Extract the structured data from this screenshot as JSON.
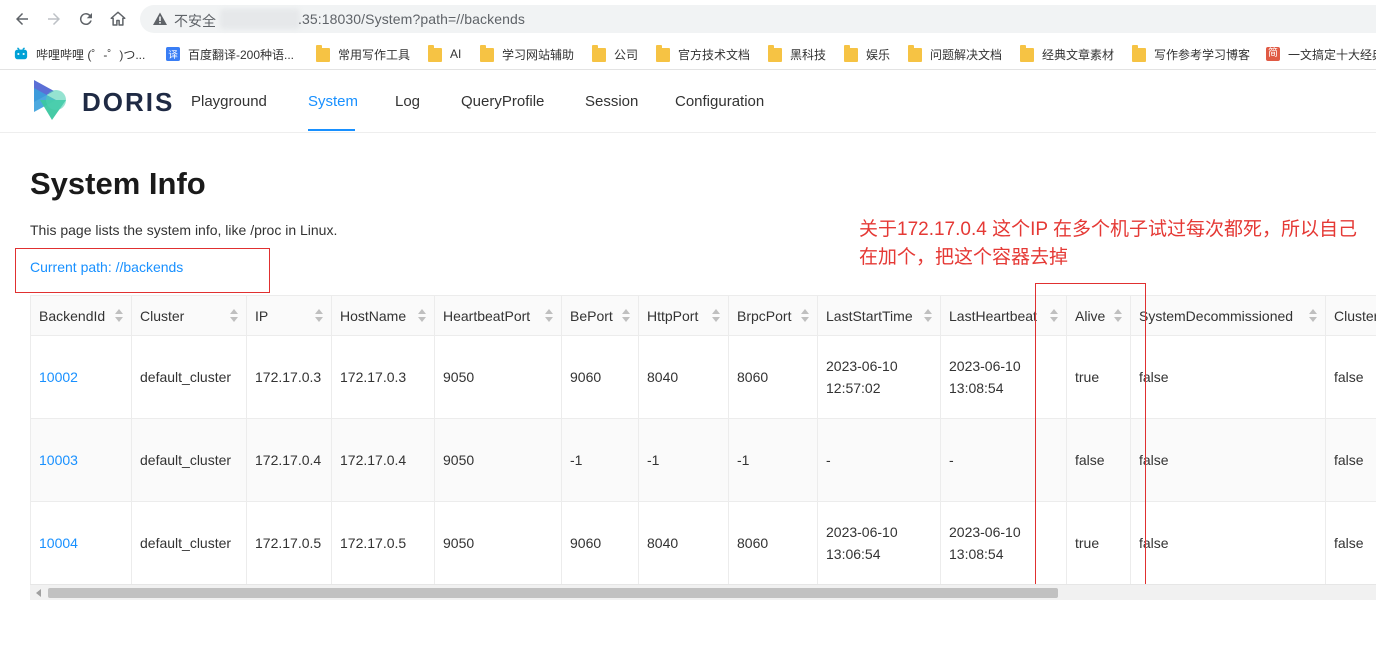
{
  "browser": {
    "insecure_label": "不安全",
    "url": ".35:18030/System?path=//backends"
  },
  "bookmarks": [
    {
      "label": "哔哩哔哩 (゜-゜)つ...",
      "icon": "bilibili-icon",
      "color": "#00a1d6"
    },
    {
      "label": "百度翻译-200种语...",
      "icon": "translate-icon",
      "color": "#3a7ef5"
    },
    {
      "label": "常用写作工具",
      "icon": "folder-icon"
    },
    {
      "label": "AI",
      "icon": "folder-icon"
    },
    {
      "label": "学习网站辅助",
      "icon": "folder-icon"
    },
    {
      "label": "公司",
      "icon": "folder-icon"
    },
    {
      "label": "官方技术文档",
      "icon": "folder-icon"
    },
    {
      "label": "黑科技",
      "icon": "folder-icon"
    },
    {
      "label": "娱乐",
      "icon": "folder-icon"
    },
    {
      "label": "问题解决文档",
      "icon": "folder-icon"
    },
    {
      "label": "经典文章素材",
      "icon": "folder-icon"
    },
    {
      "label": "写作参考学习博客",
      "icon": "folder-icon"
    },
    {
      "label": "一文搞定十大经典",
      "icon": "jian-icon",
      "glyph": "简",
      "color": "#e05a44"
    }
  ],
  "app": {
    "logo_text": "DORIS",
    "nav": [
      "Playground",
      "System",
      "Log",
      "QueryProfile",
      "Session",
      "Configuration"
    ],
    "active_nav": "System"
  },
  "page": {
    "title": "System Info",
    "description": "This page lists the system info, like /proc in Linux.",
    "current_path": "Current path: //backends"
  },
  "annotation": {
    "text": "关于172.17.0.4 这个IP 在多个机子试过每次都死，所以自己在加个，把这个容器去掉",
    "color": "#e53935"
  },
  "table": {
    "columns": [
      "BackendId",
      "Cluster",
      "IP",
      "HostName",
      "HeartbeatPort",
      "BePort",
      "HttpPort",
      "BrpcPort",
      "LastStartTime",
      "LastHeartbeat",
      "Alive",
      "SystemDecommissioned",
      "ClusterDecommissioned"
    ],
    "rows": [
      [
        "10002",
        "default_cluster",
        "172.17.0.3",
        "172.17.0.3",
        "9050",
        "9060",
        "8040",
        "8060",
        "2023-06-10 12:57:02",
        "2023-06-10 13:08:54",
        "true",
        "false",
        "false"
      ],
      [
        "10003",
        "default_cluster",
        "172.17.0.4",
        "172.17.0.4",
        "9050",
        "-1",
        "-1",
        "-1",
        "-",
        "-",
        "false",
        "false",
        "false"
      ],
      [
        "10004",
        "default_cluster",
        "172.17.0.5",
        "172.17.0.5",
        "9050",
        "9060",
        "8040",
        "8060",
        "2023-06-10 13:06:54",
        "2023-06-10 13:08:54",
        "true",
        "false",
        "false"
      ]
    ]
  },
  "colors": {
    "accent": "#1890ff",
    "annotation_red": "#e03030"
  }
}
